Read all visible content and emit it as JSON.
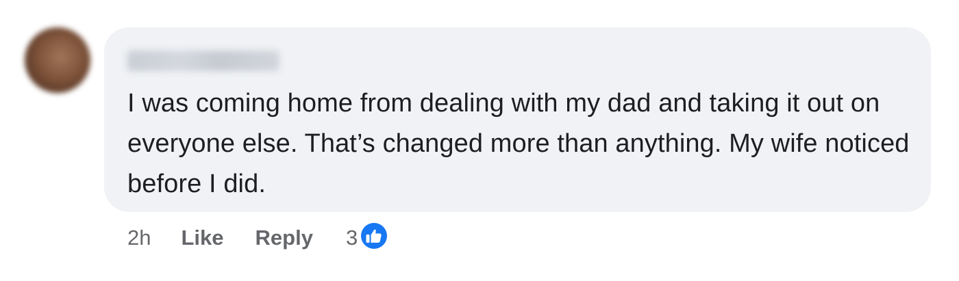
{
  "comment": {
    "author": "",
    "text": "I was coming home from dealing with my dad and taking it out on everyone else. That’s changed more than anything. My wife noticed before I did.",
    "time": "2h",
    "like_label": "Like",
    "reply_label": "Reply",
    "reaction_count": "3",
    "reaction_icon": "thumbs-up-icon",
    "colors": {
      "bubble_bg": "#f0f2f5",
      "text": "#1c1e21",
      "meta_text": "#65676b",
      "like_blue": "#1877f2"
    }
  }
}
